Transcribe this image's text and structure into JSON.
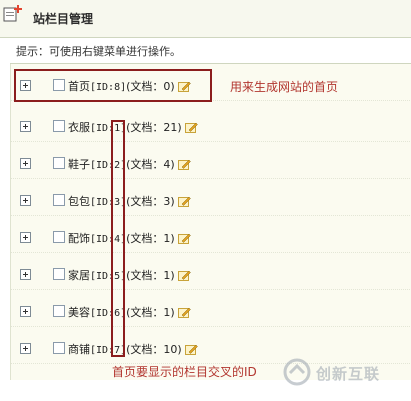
{
  "header": {
    "title": "站栏目管理",
    "icon": "add-page-icon"
  },
  "tip": "提示：可使用右键菜单进行操作。",
  "rows": [
    {
      "name": "首页",
      "id_part": "[ID:8]",
      "docs_part": "(文档：0)"
    },
    {
      "name": "衣服",
      "id_part": "[ID:1]",
      "docs_part": "(文档：21)"
    },
    {
      "name": "鞋子",
      "id_part": "[ID:2]",
      "docs_part": "(文档：4)"
    },
    {
      "name": "包包",
      "id_part": "[ID:3]",
      "docs_part": "(文档：3)"
    },
    {
      "name": "配饰",
      "id_part": "[ID:4]",
      "docs_part": "(文档：1)"
    },
    {
      "name": "家居",
      "id_part": "[ID:5]",
      "docs_part": "(文档：1)"
    },
    {
      "name": "美容",
      "id_part": "[ID:6]",
      "docs_part": "(文档：1)"
    },
    {
      "name": "商铺",
      "id_part": "[ID:7]",
      "docs_part": "(文档：10)"
    }
  ],
  "annotations": {
    "home_note": "用来生成网站的首页",
    "ids_note": "首页要显示的栏目交叉的ID"
  },
  "watermark": {
    "text": "创新互联"
  },
  "colors": {
    "annotation": "#b2362f",
    "highlight_box": "#8b1d1d",
    "row_bg": "#fbfbf0"
  }
}
